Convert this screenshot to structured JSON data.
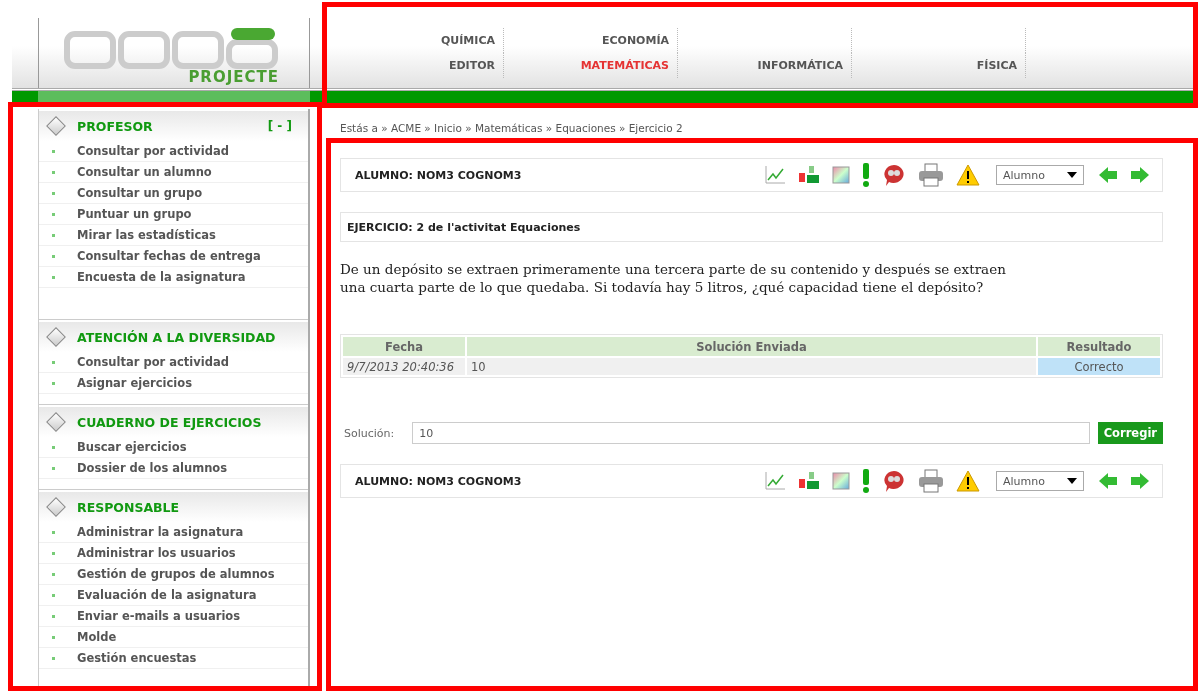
{
  "header": {
    "logo_subtitle": "PROJECTE",
    "nav_columns": [
      {
        "top": {
          "label": "QUÍMICA",
          "selected": false
        },
        "bottom": {
          "label": "EDITOR",
          "selected": false
        }
      },
      {
        "top": {
          "label": "ECONOMÍA",
          "selected": false
        },
        "bottom": {
          "label": "MATEMÁTICAS",
          "selected": true
        }
      },
      {
        "bottom": {
          "label": "INFORMÁTICA",
          "selected": false
        }
      },
      {
        "bottom": {
          "label": "FÍSICA",
          "selected": false
        }
      }
    ]
  },
  "sidebar": {
    "sections": [
      {
        "title": "PROFESOR",
        "toggle": "[ - ]",
        "items": [
          "Consultar por actividad",
          "Consultar un alumno",
          "Consultar un grupo",
          "Puntuar un grupo",
          "Mirar las estadísticas",
          "Consultar fechas de entrega",
          "Encuesta de la asignatura"
        ]
      },
      {
        "title": "ATENCIÓN A LA DIVERSIDAD",
        "items": [
          "Consultar por actividad",
          "Asignar ejercicios"
        ]
      },
      {
        "title": "CUADERNO DE EJERCICIOS",
        "items": [
          "Buscar ejercicios",
          "Dossier de los alumnos"
        ]
      },
      {
        "title": "RESPONSABLE",
        "items": [
          "Administrar la asignatura",
          "Administrar los usuarios",
          "Gestión de grupos de alumnos",
          "Evaluación de la asignatura",
          "Enviar e-mails a usuarios",
          "Molde",
          "Gestión encuestas"
        ]
      }
    ]
  },
  "breadcrumb": "Estás a » ACME » Inicio » Matemáticas » Equaciones » Ejercicio 2",
  "student_bars": [
    {
      "title": "ALUMNO: NOM3 COGNOM3",
      "select": "Alumno"
    },
    {
      "title": "ALUMNO: NOM3 COGNOM3",
      "select": "Alumno"
    }
  ],
  "exercise_title": "EJERCICIO: 2 de l'activitat Equaciones",
  "statement": "De un depósito se extraen primeramente una tercera parte de su contenido y después se extraen una cuarta parte de lo que quedaba. Si todavía hay 5 litros, ¿qué capacidad tiene el depósito?",
  "table": {
    "columns": [
      "Fecha",
      "Solución Enviada",
      "Resultado"
    ],
    "rows": [
      {
        "date": "9/7/2013 20:40:36",
        "solution": "10",
        "result": "Correcto"
      }
    ]
  },
  "answer": {
    "label": "Solución:",
    "value": "10",
    "button": "Corregir"
  }
}
